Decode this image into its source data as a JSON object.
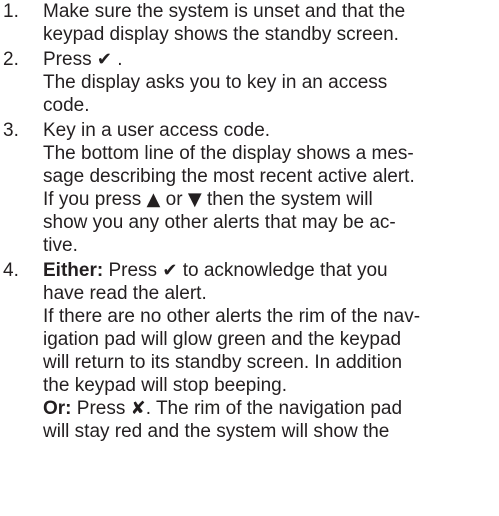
{
  "steps": [
    {
      "number": "1.",
      "lines": [
        "Make sure the system is unset and that the",
        "keypad display shows the standby screen."
      ]
    },
    {
      "number": "2.",
      "l1_text": "Press",
      "l1_end": " .",
      "lines_after": [
        "The display asks you to key in an access",
        "code."
      ]
    },
    {
      "number": "3.",
      "lines": [
        "Key in a user access code.",
        "The bottom line of the display shows a mes-",
        "sage describing the most recent active alert."
      ],
      "l4_a": "If you press",
      "l4_b": "or",
      "l4_c": "then the system will",
      "lines_after": [
        "show you any other alerts that may be ac-",
        "tive."
      ]
    },
    {
      "number": "4.",
      "either_label": "Either:",
      "either_a": " Press",
      "either_b": "to acknowledge that you",
      "lines_mid": [
        "have read the alert.",
        "If there are no other alerts the rim of the nav-",
        "igation pad will glow green and the keypad",
        "will return to its standby screen. In addition",
        "the keypad will stop beeping."
      ],
      "or_label": "Or:",
      "or_a": " Press",
      "or_b": ". The rim of the navigation pad",
      "lines_end": [
        "will stay red and the system will show the"
      ]
    }
  ],
  "icons": {
    "tick": "✔",
    "cross": "✘",
    "up": "▲",
    "down": "▼"
  }
}
